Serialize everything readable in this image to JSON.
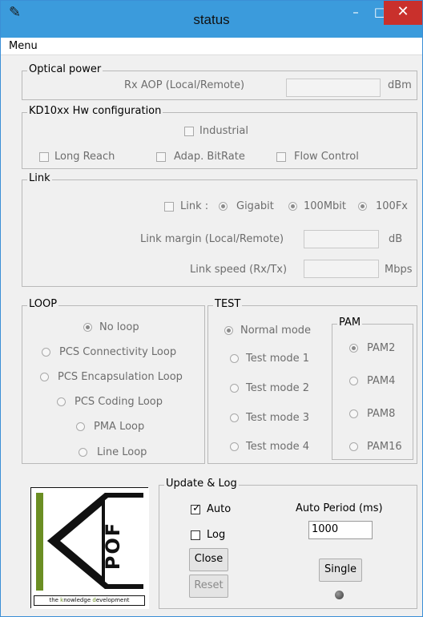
{
  "window": {
    "title": "status",
    "icon": "feather-icon",
    "minimize": "–",
    "maximize": "□",
    "close": "✕"
  },
  "menu": {
    "label": "Menu"
  },
  "optical": {
    "title": "Optical power",
    "rx_label": "Rx AOP (Local/Remote)",
    "rx_value": "",
    "unit": "dBm"
  },
  "hw": {
    "title": "KD10xx Hw configuration",
    "industrial": "Industrial",
    "long_reach": "Long Reach",
    "adap_bitrate": "Adap. BitRate",
    "flow_control": "Flow Control"
  },
  "link": {
    "title": "Link",
    "link_label": "Link :",
    "gigabit": "Gigabit",
    "mbit100": "100Mbit",
    "fx100": "100Fx",
    "margin_label": "Link margin (Local/Remote)",
    "margin_value": "",
    "margin_unit": "dB",
    "speed_label": "Link speed (Rx/Tx)",
    "speed_value": "",
    "speed_unit": "Mbps"
  },
  "loop": {
    "title": "LOOP",
    "options": [
      "No loop",
      "PCS Connectivity Loop",
      "PCS Encapsulation Loop",
      "PCS Coding Loop",
      "PMA Loop",
      "Line Loop"
    ],
    "selected": "No loop"
  },
  "test": {
    "title": "TEST",
    "options": [
      "Normal mode",
      "Test mode 1",
      "Test mode 2",
      "Test mode 3",
      "Test mode 4"
    ],
    "selected": "Normal mode"
  },
  "pam": {
    "title": "PAM",
    "options": [
      "PAM2",
      "PAM4",
      "PAM8",
      "PAM16"
    ],
    "selected": "PAM2"
  },
  "update": {
    "title": "Update & Log",
    "auto_label": "Auto",
    "auto_checked": true,
    "log_label": "Log",
    "log_checked": false,
    "period_label": "Auto Period (ms)",
    "period_value": "1000",
    "close_label": "Close",
    "reset_label": "Reset",
    "single_label": "Single"
  },
  "logo": {
    "letters": "POF",
    "tagline_pre": "the ",
    "tagline_k": "k",
    "tagline_mid": "nowledge ",
    "tagline_d": "d",
    "tagline_post": "evelopment",
    "accent_color": "#6b8e23"
  }
}
